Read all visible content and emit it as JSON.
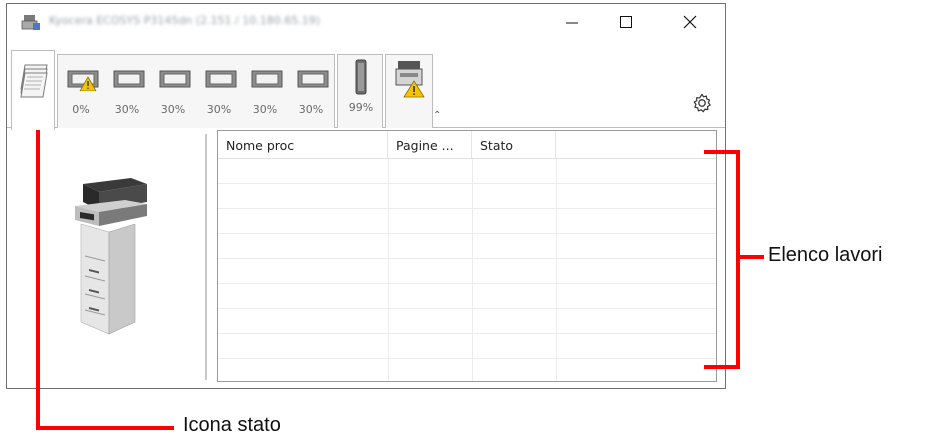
{
  "window": {
    "title": "Kyocera ECOSYS P3145dn (2.151 / 10.180.65.19)",
    "controls": {
      "minimize_icon": "minimize-icon",
      "maximize_icon": "maximize-icon",
      "close_icon": "close-icon"
    }
  },
  "status_tabs": {
    "active_tab_icon": "document-stack-icon",
    "trays": [
      {
        "level": "0%",
        "warning": true
      },
      {
        "level": "30%",
        "warning": false
      },
      {
        "level": "30%",
        "warning": false
      },
      {
        "level": "30%",
        "warning": false
      },
      {
        "level": "30%",
        "warning": false
      },
      {
        "level": "30%",
        "warning": false
      }
    ],
    "toner_level": "99%",
    "device_warning": true,
    "collapse_icon": "double-chevron-up-icon",
    "settings_icon": "gear-icon"
  },
  "job_list": {
    "columns": [
      "Nome proc",
      "Pagine ...",
      "Stato"
    ],
    "rows": 8
  },
  "annotations": {
    "job_list_label": "Elenco lavori",
    "status_icon_label": "Icona stato"
  },
  "colors": {
    "annotation": "#ff0000",
    "warning": "#f5c400"
  }
}
